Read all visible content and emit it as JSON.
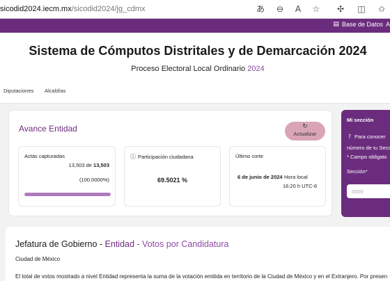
{
  "browser": {
    "url_host": "sicodid2024.iecm.mx",
    "url_path": "/sicodid2024/jg_cdmx",
    "icons": [
      "translate-icon",
      "zoom-icon",
      "read-aloud-icon",
      "favorite-star-icon",
      "extensions-icon",
      "split-screen-icon",
      "favorites-icon"
    ]
  },
  "topnav": {
    "db_link": "Base de Datos",
    "db_link_cut": "A"
  },
  "header": {
    "title": "Sistema de Cómputos Distritales y de Demarcación 2024",
    "subtitle_prefix": "Proceso Electoral Local Ordinario",
    "subtitle_year": "2024"
  },
  "tabs": [
    {
      "label": "Diputaciones"
    },
    {
      "label": "Alcaldías"
    }
  ],
  "avance": {
    "title": "Avance Entidad",
    "refresh_button": "Actualizar",
    "actas": {
      "label": "Actas capturadas",
      "captured": "13,503",
      "of": "de",
      "total": "13,503",
      "percent_text": "(100.0000%)",
      "progress_fraction": 1.0
    },
    "participacion": {
      "label": "Participación ciudadana",
      "value": "69.5021 %"
    },
    "corte": {
      "label": "Último corte",
      "date": "6 de junio de 2024",
      "local_label": "Hora local",
      "time": "16:20 h UTC-6"
    }
  },
  "mi_seccion": {
    "title": "Mi sección",
    "info_line1": "Para conocer",
    "info_line2": "número de tu Secc",
    "required_note": "* Campo obligato",
    "field_label": "Sección*",
    "placeholder": "0000"
  },
  "votos": {
    "title_prefix": "Jefatura de Gobierno - ",
    "title_entity": "Entidad",
    "title_suffix": " - Votos por Candidatura",
    "city": "Ciudad de México",
    "note": "El total de votos mostrado a nivel Entidad representa la suma de la votación emitida en territorio de la Ciudad de México y en el Extranjero. Por presen"
  },
  "colors": {
    "brand_purple": "#6b2c7e",
    "accent_purple": "#8e4aa3",
    "refresh_button_bg": "#d9a5b6",
    "progress_fill": "#b07bbd"
  }
}
